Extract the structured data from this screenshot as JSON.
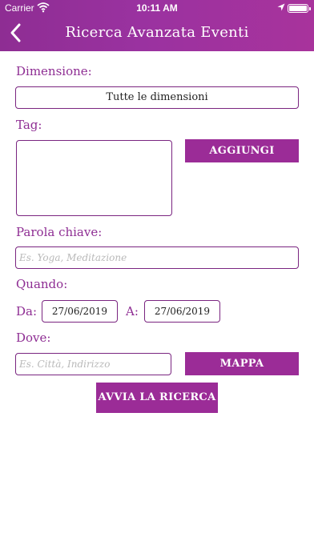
{
  "status_bar": {
    "carrier": "Carrier",
    "time": "10:11 AM",
    "battery_level": 1.0
  },
  "nav": {
    "title": "Ricerca Avanzata Eventi",
    "back_icon": "chevron-left-icon"
  },
  "colors": {
    "accent": "#9b2c97",
    "header": "#8e2d93",
    "label": "#8e2d93",
    "placeholder": "#b9b9b9"
  },
  "form": {
    "dimension_label": "Dimensione:",
    "dimension_value": "Tutte le dimensioni",
    "tag_label": "Tag:",
    "add_button": "AGGIUNGI",
    "keyword_label": "Parola chiave:",
    "keyword_placeholder": "Es. Yoga, Meditazione",
    "when_label": "Quando:",
    "from_label": "Da:",
    "from_value": "27/06/2019",
    "to_label": "A:",
    "to_value": "27/06/2019",
    "where_label": "Dove:",
    "where_placeholder": "Es. Città, Indirizzo",
    "map_button": "MAPPA",
    "search_button": "AVVIA LA RICERCA"
  }
}
